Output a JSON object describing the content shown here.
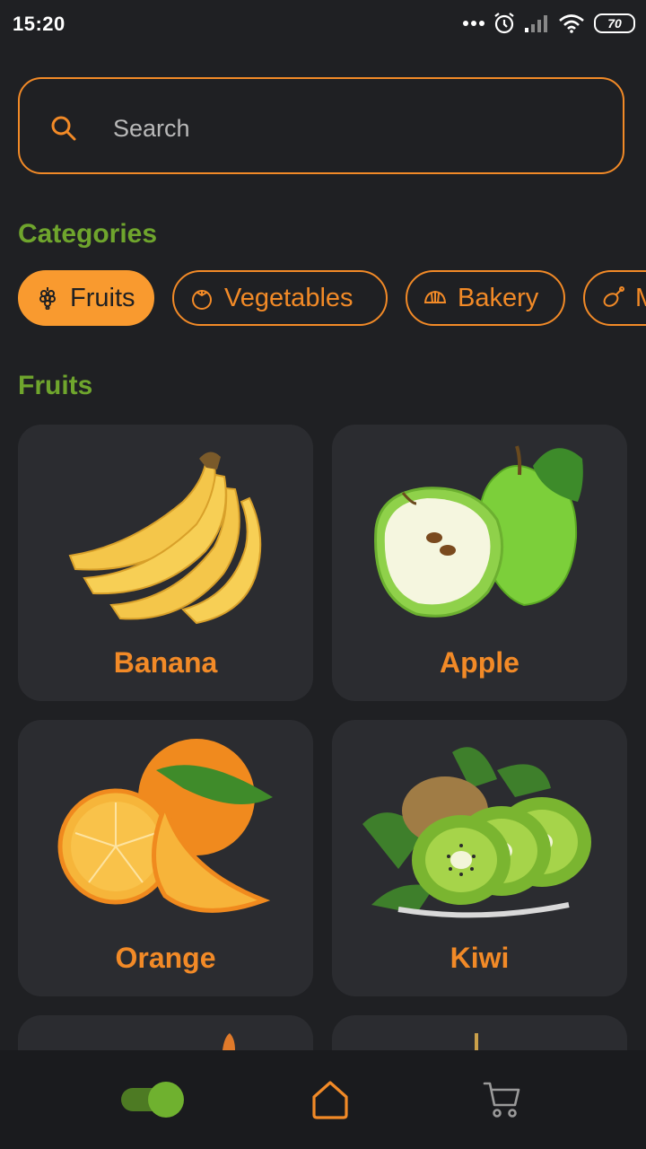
{
  "status_bar": {
    "time": "15:20",
    "battery": "70",
    "icons": [
      "more-dots-icon",
      "alarm-icon",
      "signal-icon",
      "wifi-icon",
      "battery-icon"
    ]
  },
  "search": {
    "placeholder": "Search",
    "value": "",
    "icon": "search-icon"
  },
  "categories": {
    "title": "Categories",
    "items": [
      {
        "label": "Fruits",
        "icon": "grapes-icon",
        "active": true
      },
      {
        "label": "Vegetables",
        "icon": "tomato-icon",
        "active": false
      },
      {
        "label": "Bakery",
        "icon": "croissant-icon",
        "active": false
      },
      {
        "label": "M",
        "icon": "meat-icon",
        "active": false
      }
    ]
  },
  "products": {
    "title": "Fruits",
    "items": [
      {
        "name": "Banana",
        "image": "banana-image"
      },
      {
        "name": "Apple",
        "image": "apple-image"
      },
      {
        "name": "Orange",
        "image": "orange-image"
      },
      {
        "name": "Kiwi",
        "image": "kiwi-image"
      }
    ]
  },
  "bottom_nav": {
    "items": [
      {
        "icon": "theme-toggle",
        "toggle_on": true
      },
      {
        "icon": "home-icon",
        "active": true
      },
      {
        "icon": "cart-icon",
        "active": false
      }
    ]
  },
  "colors": {
    "background": "#1f2023",
    "card": "#2b2c30",
    "accent_orange": "#f28a27",
    "accent_green": "#6fa52d",
    "nav_background": "#1a1b1e"
  }
}
